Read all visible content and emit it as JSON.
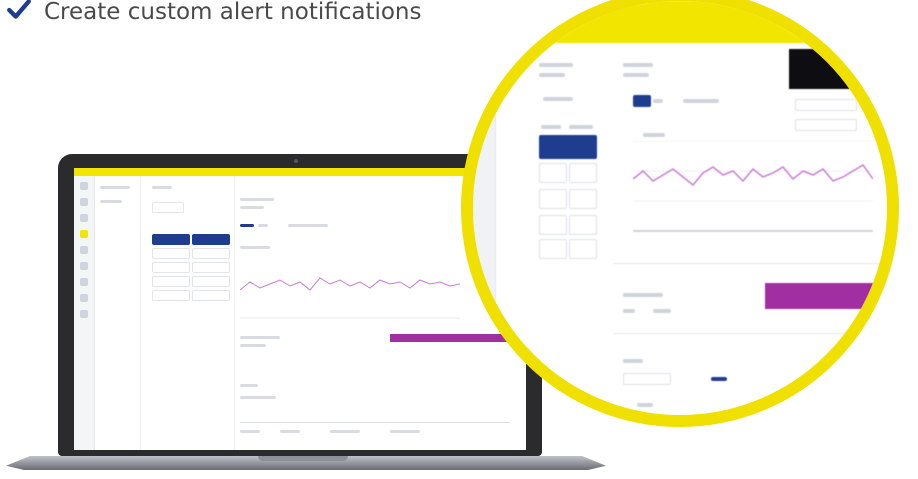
{
  "caption": {
    "text": "Create custom alert notifications",
    "icon": "checkmark-icon",
    "icon_color": "#1f3d8f"
  },
  "colors": {
    "accent_yellow": "#f2e500",
    "primary_blue": "#1f3d8f",
    "bar_purple": "#a22fa2",
    "chart_line": "#c77dd3"
  }
}
